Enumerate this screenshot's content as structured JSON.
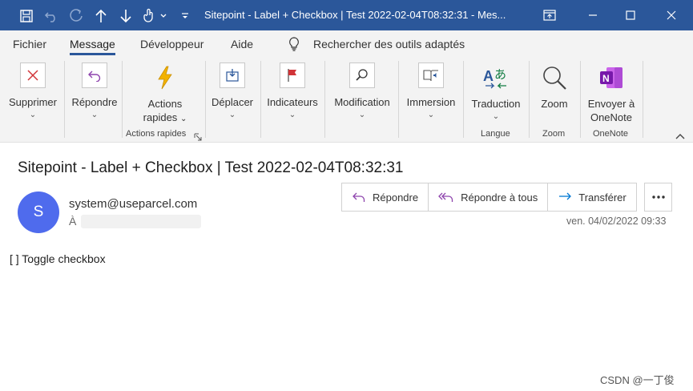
{
  "window": {
    "title": "Sitepoint - Label + Checkbox | Test 2022-02-04T08:32:31  -  Mes..."
  },
  "tabs": [
    {
      "label": "Fichier"
    },
    {
      "label": "Message"
    },
    {
      "label": "Développeur"
    },
    {
      "label": "Aide"
    }
  ],
  "search": {
    "label": "Rechercher des outils adaptés"
  },
  "ribbon": {
    "delete": "Supprimer",
    "reply": "Répondre",
    "quick_actions_1": "Actions",
    "quick_actions_2": "rapides",
    "group_quick_actions": "Actions rapides",
    "move": "Déplacer",
    "flags": "Indicateurs",
    "edit": "Modification",
    "immersive": "Immersion",
    "translate": "Traduction",
    "group_language": "Langue",
    "zoom": "Zoom",
    "group_zoom": "Zoom",
    "onenote_1": "Envoyer à",
    "onenote_2": "OneNote",
    "group_onenote": "OneNote"
  },
  "message": {
    "subject": "Sitepoint - Label + Checkbox | Test 2022-02-04T08:32:31",
    "avatar_initial": "S",
    "sender": "system@useparcel.com",
    "to_label": "À",
    "reply": "Répondre",
    "reply_all": "Répondre à tous",
    "forward": "Transférer",
    "date": "ven. 04/02/2022 09:33",
    "body": "[ ] Toggle checkbox"
  },
  "watermark": "CSDN @一丁俊",
  "colors": {
    "accent": "#2b579a",
    "avatar": "#4f6bed",
    "reply_icon": "#8e44ad",
    "forward_icon": "#0078d4"
  }
}
